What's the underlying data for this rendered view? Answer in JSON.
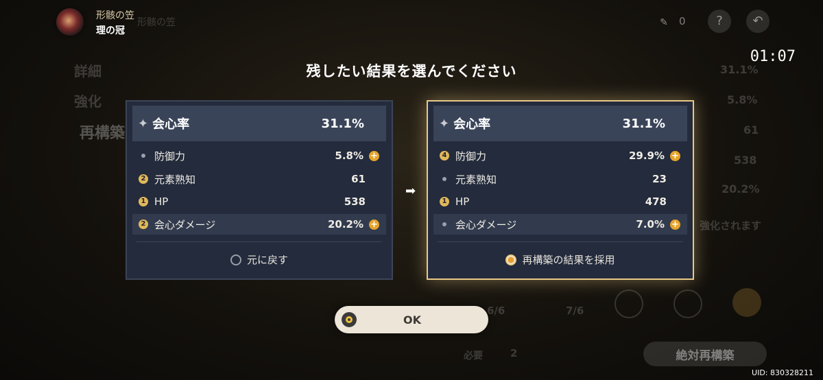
{
  "header": {
    "artifact_name": "形骸の笠",
    "slot_name": "理の冠",
    "bg_artifact_name": "形骸の笠"
  },
  "top_right": {
    "material_count": "0",
    "help_glyph": "?",
    "back_glyph": "↶"
  },
  "timer": "01:07",
  "prompt": "残したい結果を選んでください",
  "background": {
    "menu": [
      "詳細",
      "強化",
      "再構築"
    ],
    "values": [
      "31.1%",
      "5.8%",
      "61",
      "538",
      "20.2%"
    ],
    "enhance_hint": "強化されます",
    "progress_left": "6/6",
    "progress_right": "7/6",
    "required_label": "必要",
    "required_count": "2",
    "absolute_button": "絶対再構築"
  },
  "left_card": {
    "main": {
      "name": "会心率",
      "value": "31.1%"
    },
    "subs": [
      {
        "marker": "",
        "name": "防御力",
        "value": "5.8%",
        "plus": true
      },
      {
        "marker": "2",
        "name": "元素熟知",
        "value": "61",
        "plus": false
      },
      {
        "marker": "1",
        "name": "HP",
        "value": "538",
        "plus": false
      },
      {
        "marker": "2",
        "name": "会心ダメージ",
        "value": "20.2%",
        "plus": true
      }
    ],
    "choice_label": "元に戻す",
    "selected": false
  },
  "right_card": {
    "main": {
      "name": "会心率",
      "value": "31.1%"
    },
    "subs": [
      {
        "marker": "4",
        "name": "防御力",
        "value": "29.9%",
        "plus": true
      },
      {
        "marker": "",
        "name": "元素熟知",
        "value": "23",
        "plus": false
      },
      {
        "marker": "1",
        "name": "HP",
        "value": "478",
        "plus": false
      },
      {
        "marker": "",
        "name": "会心ダメージ",
        "value": "7.0%",
        "plus": true
      }
    ],
    "choice_label": "再構築の結果を採用",
    "selected": true
  },
  "ok_label": "OK",
  "uid": "UID: 830328211",
  "icons": {
    "star": "✦",
    "arrow": "➡",
    "plus": "+"
  }
}
